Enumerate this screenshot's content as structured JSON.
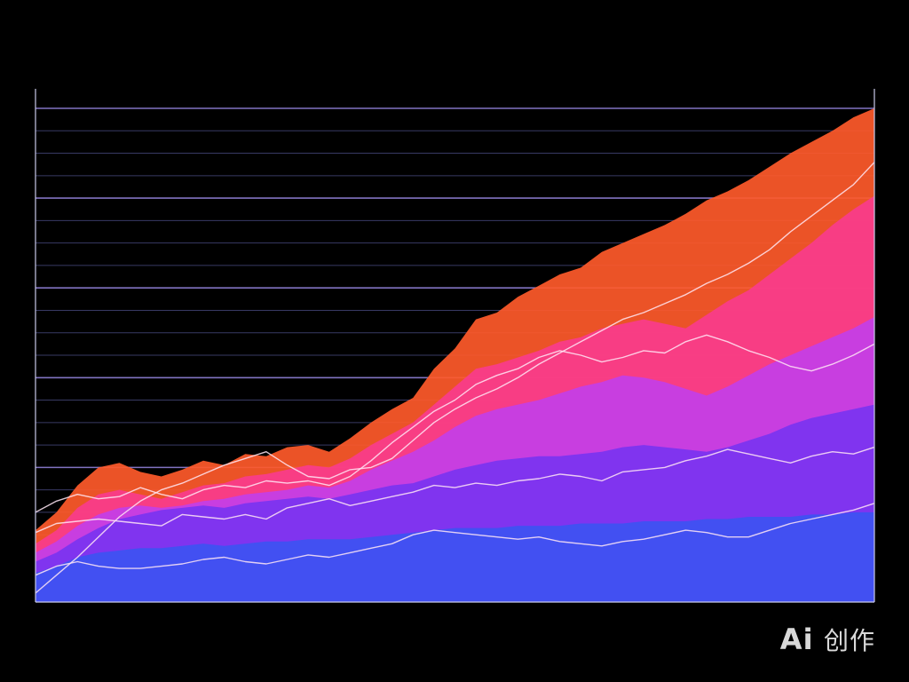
{
  "chart_data": {
    "type": "area",
    "title": "",
    "xlabel": "",
    "ylabel": "",
    "grid": true,
    "legend": "none",
    "ylim": [
      0,
      22
    ],
    "x": [
      0,
      1,
      2,
      3,
      4,
      5,
      6,
      7,
      8,
      9,
      10,
      11,
      12,
      13,
      14,
      15,
      16,
      17,
      18,
      19,
      20,
      21,
      22,
      23,
      24,
      25,
      26,
      27,
      28,
      29,
      30,
      31,
      32,
      33,
      34,
      35,
      36,
      37,
      38,
      39,
      40
    ],
    "series": [
      {
        "color": "#ff5a2a",
        "values": [
          3.2,
          4.0,
          5.2,
          6.0,
          6.2,
          5.8,
          5.6,
          5.9,
          6.3,
          6.1,
          6.6,
          6.5,
          6.9,
          7.0,
          6.7,
          7.3,
          8.0,
          8.6,
          9.1,
          10.4,
          11.3,
          12.6,
          12.9,
          13.6,
          14.1,
          14.6,
          14.9,
          15.6,
          16.0,
          16.4,
          16.8,
          17.3,
          17.9,
          18.3,
          18.8,
          19.4,
          20.0,
          20.5,
          21.0,
          21.6,
          22.0
        ]
      },
      {
        "color": "#f93c8c",
        "values": [
          2.6,
          3.2,
          4.2,
          4.8,
          5.0,
          4.8,
          4.6,
          4.9,
          5.2,
          5.3,
          5.6,
          5.7,
          5.9,
          6.1,
          6.0,
          6.4,
          7.0,
          7.5,
          8.0,
          8.8,
          9.6,
          10.4,
          10.6,
          10.9,
          11.2,
          11.6,
          11.8,
          12.2,
          12.4,
          12.6,
          12.4,
          12.2,
          12.8,
          13.4,
          13.9,
          14.6,
          15.3,
          16.0,
          16.8,
          17.5,
          18.1
        ]
      },
      {
        "color": "#c33ee8",
        "values": [
          2.2,
          2.7,
          3.4,
          3.9,
          4.2,
          4.3,
          4.2,
          4.3,
          4.5,
          4.6,
          4.8,
          4.9,
          5.0,
          5.2,
          5.1,
          5.4,
          5.9,
          6.3,
          6.7,
          7.2,
          7.8,
          8.3,
          8.6,
          8.8,
          9.0,
          9.3,
          9.6,
          9.8,
          10.1,
          10.0,
          9.8,
          9.5,
          9.2,
          9.6,
          10.1,
          10.6,
          11.0,
          11.4,
          11.8,
          12.2,
          12.7
        ]
      },
      {
        "color": "#7a33f0",
        "values": [
          1.8,
          2.2,
          2.8,
          3.3,
          3.7,
          3.9,
          4.1,
          4.2,
          4.3,
          4.2,
          4.4,
          4.5,
          4.6,
          4.7,
          4.6,
          4.8,
          5.0,
          5.2,
          5.3,
          5.6,
          5.9,
          6.1,
          6.3,
          6.4,
          6.5,
          6.5,
          6.6,
          6.7,
          6.9,
          7.0,
          6.9,
          6.8,
          6.7,
          6.9,
          7.2,
          7.5,
          7.9,
          8.2,
          8.4,
          8.6,
          8.8
        ]
      },
      {
        "color": "#3d52f2",
        "values": [
          1.3,
          1.6,
          2.0,
          2.2,
          2.3,
          2.4,
          2.4,
          2.5,
          2.6,
          2.5,
          2.6,
          2.7,
          2.7,
          2.8,
          2.8,
          2.8,
          2.9,
          3.0,
          3.1,
          3.2,
          3.3,
          3.3,
          3.3,
          3.4,
          3.4,
          3.4,
          3.5,
          3.5,
          3.5,
          3.6,
          3.6,
          3.6,
          3.7,
          3.7,
          3.8,
          3.8,
          3.8,
          3.9,
          3.9,
          4.0,
          4.0
        ]
      }
    ],
    "lines": [
      {
        "color": "#ffe6f4",
        "values": [
          0.4,
          1.2,
          2.0,
          2.9,
          3.8,
          4.5,
          5.0,
          5.3,
          5.7,
          6.1,
          6.4,
          6.7,
          6.1,
          5.6,
          5.5,
          5.9,
          6.0,
          6.4,
          7.2,
          8.0,
          8.6,
          9.1,
          9.5,
          10.0,
          10.6,
          11.1,
          11.6,
          12.1,
          12.6,
          12.9,
          13.3,
          13.7,
          14.2,
          14.6,
          15.1,
          15.7,
          16.5,
          17.2,
          17.9,
          18.6,
          19.6
        ]
      },
      {
        "color": "#ffe6f4",
        "values": [
          4.0,
          4.5,
          4.8,
          4.6,
          4.7,
          5.1,
          4.8,
          4.6,
          5.0,
          5.2,
          5.1,
          5.4,
          5.3,
          5.4,
          5.2,
          5.6,
          6.3,
          7.1,
          7.8,
          8.5,
          9.0,
          9.7,
          10.1,
          10.4,
          10.9,
          11.2,
          11.0,
          10.7,
          10.9,
          11.2,
          11.1,
          11.6,
          11.9,
          11.6,
          11.2,
          10.9,
          10.5,
          10.3,
          10.6,
          11.0,
          11.5
        ]
      },
      {
        "color": "#ffe6f4",
        "values": [
          3.1,
          3.5,
          3.6,
          3.7,
          3.6,
          3.5,
          3.4,
          3.9,
          3.8,
          3.7,
          3.9,
          3.7,
          4.2,
          4.4,
          4.6,
          4.3,
          4.5,
          4.7,
          4.9,
          5.2,
          5.1,
          5.3,
          5.2,
          5.4,
          5.5,
          5.7,
          5.6,
          5.4,
          5.8,
          5.9,
          6.0,
          6.3,
          6.5,
          6.8,
          6.6,
          6.4,
          6.2,
          6.5,
          6.7,
          6.6,
          6.9
        ]
      },
      {
        "color": "#ffe6f4",
        "values": [
          1.2,
          1.6,
          1.8,
          1.6,
          1.5,
          1.5,
          1.6,
          1.7,
          1.9,
          2.0,
          1.8,
          1.7,
          1.9,
          2.1,
          2.0,
          2.2,
          2.4,
          2.6,
          3.0,
          3.2,
          3.1,
          3.0,
          2.9,
          2.8,
          2.9,
          2.7,
          2.6,
          2.5,
          2.7,
          2.8,
          3.0,
          3.2,
          3.1,
          2.9,
          2.9,
          3.2,
          3.5,
          3.7,
          3.9,
          4.1,
          4.4
        ]
      }
    ]
  },
  "watermark": {
    "ai": "Ai",
    "text": "创作"
  }
}
